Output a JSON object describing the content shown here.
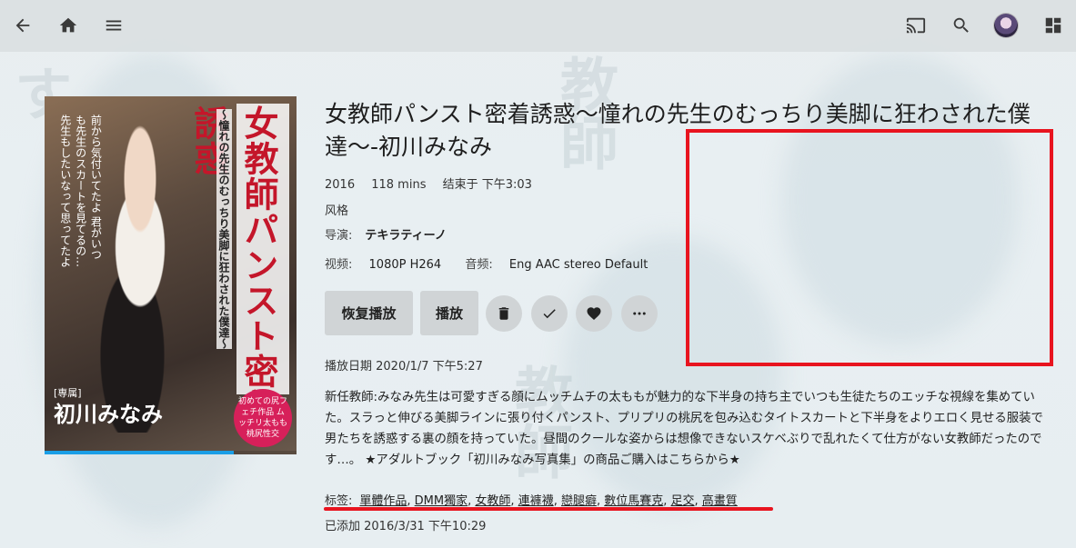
{
  "topbar": {
    "icons": [
      "back-arrow-icon",
      "home-icon",
      "menu-icon",
      "cast-icon",
      "search-icon",
      "avatar",
      "grid-icon"
    ]
  },
  "poster": {
    "title_vertical": "女教師パンスト密着誘惑",
    "subtitle_vertical": "〜憧れの先生のむっちり美脚に狂わされた僕達〜",
    "quote_vertical": "前から気付いてたよ 君がいつも先生のスカートを見てるの… 先生もしたいなって思ってたよ",
    "label_small": "[専属]",
    "actress": "初川みなみ",
    "badge": "初めての尻フェチ作品 ムッチリ太もも 桃尻性交",
    "progress_percent": 75
  },
  "details": {
    "title": "女教師パンスト密着誘惑～憧れの先生のむっちり美脚に狂わされた僕達～-初川みなみ",
    "year": "2016",
    "runtime": "118 mins",
    "ends_at": "结束于 下午3:03",
    "genre_label": "风格",
    "director_label": "导演:",
    "director": "テキラティーノ",
    "video_label": "视频:",
    "video": "1080P H264",
    "audio_label": "音频:",
    "audio": "Eng AAC stereo Default",
    "resume_button": "恢复播放",
    "play_button": "播放",
    "played_date": "播放日期 2020/1/7 下午5:27",
    "description": "新任教師:みなみ先生は可愛すぎる顔にムッチムチの太ももが魅力的な下半身の持ち主でいつも生徒たちのエッチな視線を集めていた。スラっと伸びる美脚ラインに張り付くパンスト、プリプリの桃尻を包み込むタイトスカートと下半身をよりエロく見せる服装で男たちを誘惑する裏の顔を持っていた。昼間のクールな姿からは想像できないスケベぶりで乱れたくて仕方がない女教師だったのです…。 ★アダルトブック「初川みなみ写真集」の商品ご購入はこちらから★",
    "tags_label": "标签:",
    "tags": [
      "單體作品",
      "DMM獨家",
      "女教師",
      "連褲襪",
      "戀腿癖",
      "數位馬賽克",
      "足交",
      "高畫質"
    ],
    "date_added": "已添加 2016/3/31 下午10:29"
  },
  "colors": {
    "accent_progress": "#1a9ee6",
    "annotation_red": "#e8141f"
  }
}
